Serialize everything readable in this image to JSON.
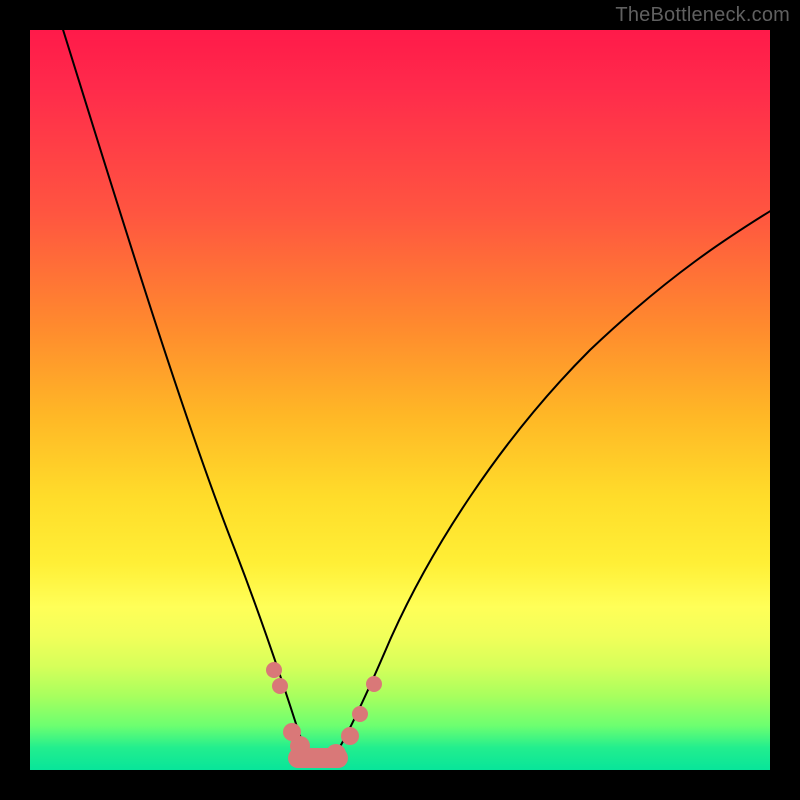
{
  "watermark": "TheBottleneck.com",
  "colors": {
    "marker": "#d97878",
    "curve": "#000000",
    "frame": "#000000"
  },
  "chart_data": {
    "type": "line",
    "title": "",
    "xlabel": "",
    "ylabel": "",
    "xlim": [
      0,
      100
    ],
    "ylim": [
      0,
      100
    ],
    "grid": false,
    "legend": false,
    "series": [
      {
        "name": "left-curve",
        "x": [
          4,
          10,
          16,
          22,
          26,
          29,
          31,
          33,
          35,
          36,
          37,
          38
        ],
        "y": [
          100,
          82,
          62,
          40,
          24,
          14,
          9,
          6,
          3,
          2,
          1,
          0.5
        ]
      },
      {
        "name": "right-curve",
        "x": [
          40,
          42,
          44,
          47,
          52,
          60,
          70,
          82,
          100
        ],
        "y": [
          0.5,
          2,
          5,
          11,
          22,
          38,
          52,
          64,
          76
        ]
      }
    ],
    "markers": {
      "name": "highlighted-points",
      "x": [
        32,
        33,
        35,
        36.5,
        38,
        39.5,
        41,
        42.5,
        44,
        46
      ],
      "y": [
        13,
        10,
        4,
        2,
        1,
        1,
        2,
        4,
        8,
        12
      ]
    },
    "note": "Axis values are normalized 0–100; no numeric labels are rendered in the image."
  }
}
